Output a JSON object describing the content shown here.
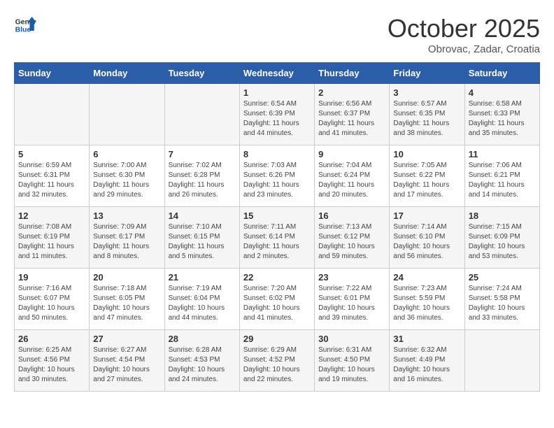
{
  "header": {
    "logo_general": "General",
    "logo_blue": "Blue",
    "month": "October 2025",
    "location": "Obrovac, Zadar, Croatia"
  },
  "weekdays": [
    "Sunday",
    "Monday",
    "Tuesday",
    "Wednesday",
    "Thursday",
    "Friday",
    "Saturday"
  ],
  "weeks": [
    [
      {
        "day": "",
        "sunrise": "",
        "sunset": "",
        "daylight": ""
      },
      {
        "day": "",
        "sunrise": "",
        "sunset": "",
        "daylight": ""
      },
      {
        "day": "",
        "sunrise": "",
        "sunset": "",
        "daylight": ""
      },
      {
        "day": "1",
        "sunrise": "Sunrise: 6:54 AM",
        "sunset": "Sunset: 6:39 PM",
        "daylight": "Daylight: 11 hours and 44 minutes."
      },
      {
        "day": "2",
        "sunrise": "Sunrise: 6:56 AM",
        "sunset": "Sunset: 6:37 PM",
        "daylight": "Daylight: 11 hours and 41 minutes."
      },
      {
        "day": "3",
        "sunrise": "Sunrise: 6:57 AM",
        "sunset": "Sunset: 6:35 PM",
        "daylight": "Daylight: 11 hours and 38 minutes."
      },
      {
        "day": "4",
        "sunrise": "Sunrise: 6:58 AM",
        "sunset": "Sunset: 6:33 PM",
        "daylight": "Daylight: 11 hours and 35 minutes."
      }
    ],
    [
      {
        "day": "5",
        "sunrise": "Sunrise: 6:59 AM",
        "sunset": "Sunset: 6:31 PM",
        "daylight": "Daylight: 11 hours and 32 minutes."
      },
      {
        "day": "6",
        "sunrise": "Sunrise: 7:00 AM",
        "sunset": "Sunset: 6:30 PM",
        "daylight": "Daylight: 11 hours and 29 minutes."
      },
      {
        "day": "7",
        "sunrise": "Sunrise: 7:02 AM",
        "sunset": "Sunset: 6:28 PM",
        "daylight": "Daylight: 11 hours and 26 minutes."
      },
      {
        "day": "8",
        "sunrise": "Sunrise: 7:03 AM",
        "sunset": "Sunset: 6:26 PM",
        "daylight": "Daylight: 11 hours and 23 minutes."
      },
      {
        "day": "9",
        "sunrise": "Sunrise: 7:04 AM",
        "sunset": "Sunset: 6:24 PM",
        "daylight": "Daylight: 11 hours and 20 minutes."
      },
      {
        "day": "10",
        "sunrise": "Sunrise: 7:05 AM",
        "sunset": "Sunset: 6:22 PM",
        "daylight": "Daylight: 11 hours and 17 minutes."
      },
      {
        "day": "11",
        "sunrise": "Sunrise: 7:06 AM",
        "sunset": "Sunset: 6:21 PM",
        "daylight": "Daylight: 11 hours and 14 minutes."
      }
    ],
    [
      {
        "day": "12",
        "sunrise": "Sunrise: 7:08 AM",
        "sunset": "Sunset: 6:19 PM",
        "daylight": "Daylight: 11 hours and 11 minutes."
      },
      {
        "day": "13",
        "sunrise": "Sunrise: 7:09 AM",
        "sunset": "Sunset: 6:17 PM",
        "daylight": "Daylight: 11 hours and 8 minutes."
      },
      {
        "day": "14",
        "sunrise": "Sunrise: 7:10 AM",
        "sunset": "Sunset: 6:15 PM",
        "daylight": "Daylight: 11 hours and 5 minutes."
      },
      {
        "day": "15",
        "sunrise": "Sunrise: 7:11 AM",
        "sunset": "Sunset: 6:14 PM",
        "daylight": "Daylight: 11 hours and 2 minutes."
      },
      {
        "day": "16",
        "sunrise": "Sunrise: 7:13 AM",
        "sunset": "Sunset: 6:12 PM",
        "daylight": "Daylight: 10 hours and 59 minutes."
      },
      {
        "day": "17",
        "sunrise": "Sunrise: 7:14 AM",
        "sunset": "Sunset: 6:10 PM",
        "daylight": "Daylight: 10 hours and 56 minutes."
      },
      {
        "day": "18",
        "sunrise": "Sunrise: 7:15 AM",
        "sunset": "Sunset: 6:09 PM",
        "daylight": "Daylight: 10 hours and 53 minutes."
      }
    ],
    [
      {
        "day": "19",
        "sunrise": "Sunrise: 7:16 AM",
        "sunset": "Sunset: 6:07 PM",
        "daylight": "Daylight: 10 hours and 50 minutes."
      },
      {
        "day": "20",
        "sunrise": "Sunrise: 7:18 AM",
        "sunset": "Sunset: 6:05 PM",
        "daylight": "Daylight: 10 hours and 47 minutes."
      },
      {
        "day": "21",
        "sunrise": "Sunrise: 7:19 AM",
        "sunset": "Sunset: 6:04 PM",
        "daylight": "Daylight: 10 hours and 44 minutes."
      },
      {
        "day": "22",
        "sunrise": "Sunrise: 7:20 AM",
        "sunset": "Sunset: 6:02 PM",
        "daylight": "Daylight: 10 hours and 41 minutes."
      },
      {
        "day": "23",
        "sunrise": "Sunrise: 7:22 AM",
        "sunset": "Sunset: 6:01 PM",
        "daylight": "Daylight: 10 hours and 39 minutes."
      },
      {
        "day": "24",
        "sunrise": "Sunrise: 7:23 AM",
        "sunset": "Sunset: 5:59 PM",
        "daylight": "Daylight: 10 hours and 36 minutes."
      },
      {
        "day": "25",
        "sunrise": "Sunrise: 7:24 AM",
        "sunset": "Sunset: 5:58 PM",
        "daylight": "Daylight: 10 hours and 33 minutes."
      }
    ],
    [
      {
        "day": "26",
        "sunrise": "Sunrise: 6:25 AM",
        "sunset": "Sunset: 4:56 PM",
        "daylight": "Daylight: 10 hours and 30 minutes."
      },
      {
        "day": "27",
        "sunrise": "Sunrise: 6:27 AM",
        "sunset": "Sunset: 4:54 PM",
        "daylight": "Daylight: 10 hours and 27 minutes."
      },
      {
        "day": "28",
        "sunrise": "Sunrise: 6:28 AM",
        "sunset": "Sunset: 4:53 PM",
        "daylight": "Daylight: 10 hours and 24 minutes."
      },
      {
        "day": "29",
        "sunrise": "Sunrise: 6:29 AM",
        "sunset": "Sunset: 4:52 PM",
        "daylight": "Daylight: 10 hours and 22 minutes."
      },
      {
        "day": "30",
        "sunrise": "Sunrise: 6:31 AM",
        "sunset": "Sunset: 4:50 PM",
        "daylight": "Daylight: 10 hours and 19 minutes."
      },
      {
        "day": "31",
        "sunrise": "Sunrise: 6:32 AM",
        "sunset": "Sunset: 4:49 PM",
        "daylight": "Daylight: 10 hours and 16 minutes."
      },
      {
        "day": "",
        "sunrise": "",
        "sunset": "",
        "daylight": ""
      }
    ]
  ]
}
